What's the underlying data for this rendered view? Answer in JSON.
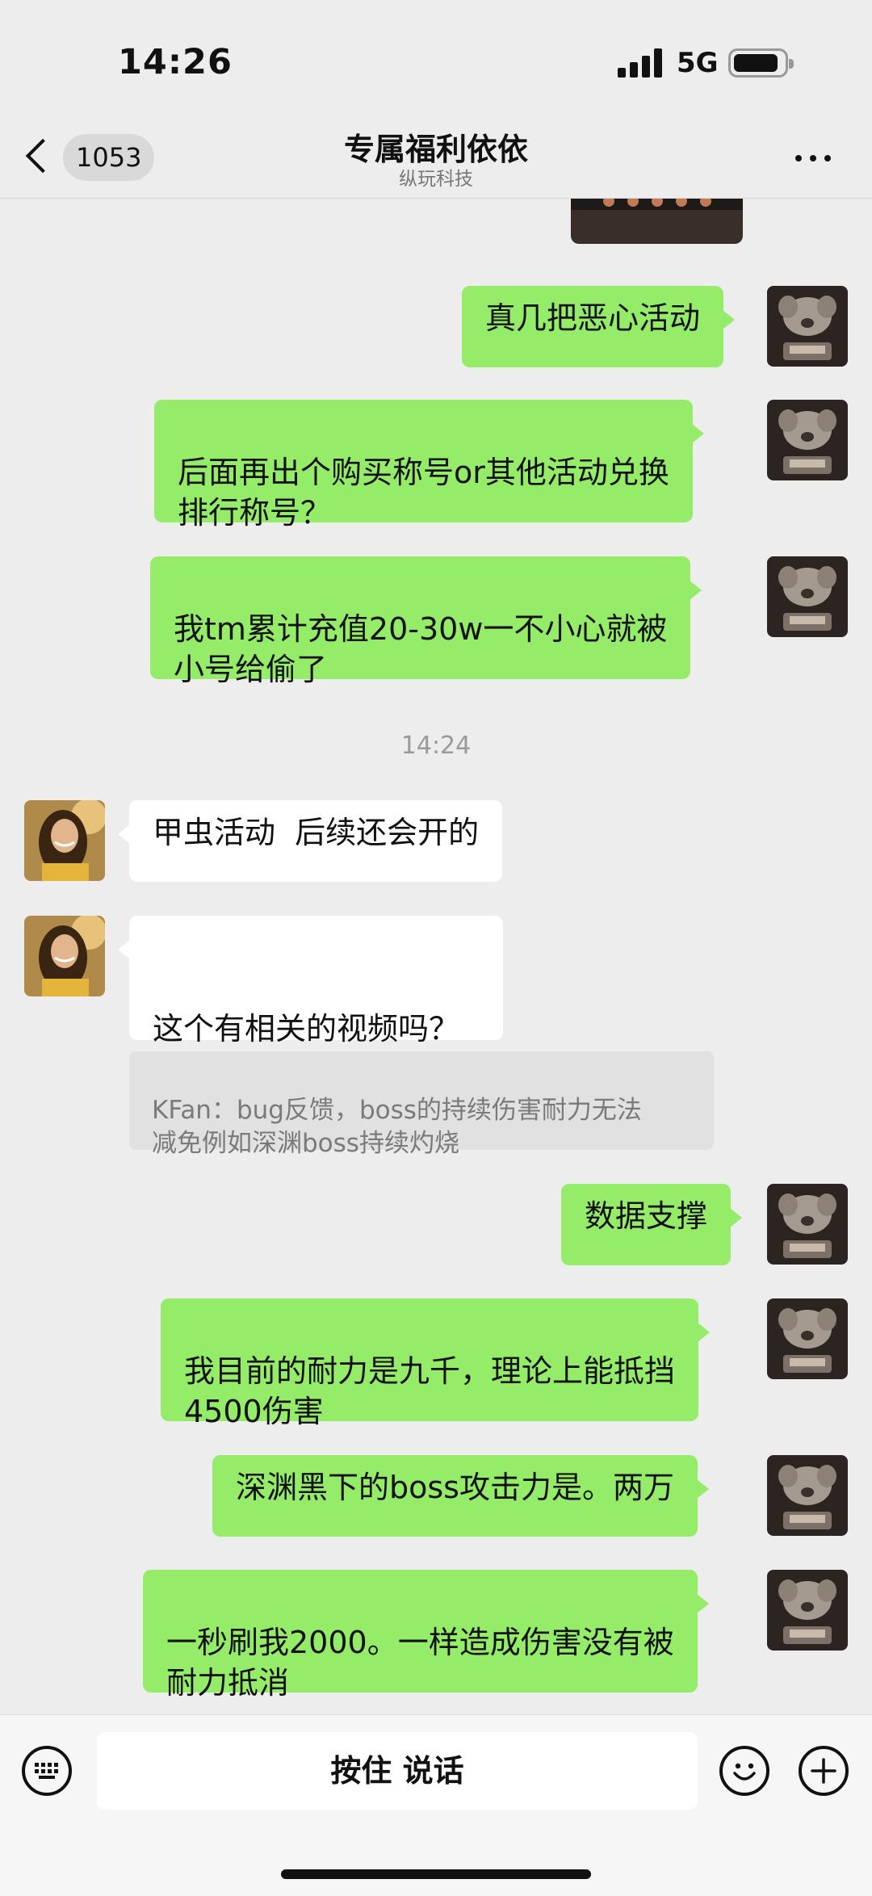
{
  "status_bar": {
    "time": "14:26",
    "network": "5G",
    "signal_icon": "signal-bars-icon",
    "battery_icon": "battery-icon"
  },
  "nav": {
    "back_icon": "chevron-left-icon",
    "unread_count": "1053",
    "title": "专属福利依依",
    "subtitle": "纵玩科技",
    "more_icon": "more-horizontal-icon"
  },
  "messages": [
    {
      "side": "out",
      "text": "真几把恶心活动"
    },
    {
      "side": "out",
      "text": "后面再出个购买称号or其他活动兑换\n排行称号？"
    },
    {
      "side": "out",
      "text": "我tm累计充值20-30w一不小心就被\n小号给偷了"
    },
    {
      "side": "in",
      "text": "甲虫活动  后续还会开的"
    },
    {
      "side": "in",
      "text": "\n这个有相关的视频吗？"
    },
    {
      "side": "out",
      "text": "数据支撑"
    },
    {
      "side": "out",
      "text": "我目前的耐力是九千，理论上能抵挡\n4500伤害"
    },
    {
      "side": "out",
      "text": "深渊黑下的boss攻击力是。两万"
    },
    {
      "side": "out",
      "text": "一秒刷我2000。一样造成伤害没有被\n耐力抵消"
    }
  ],
  "timestamp": "14:24",
  "quote": {
    "text": "KFan：bug反馈，boss的持续伤害耐力无法\n减免例如深渊boss持续灼烧"
  },
  "input_bar": {
    "voice_label": "按住 说话",
    "keyboard_icon": "keyboard-icon",
    "emoji_icon": "emoji-smile-icon",
    "plus_icon": "plus-circle-icon"
  },
  "colors": {
    "outgoing_bubble": "#95ec69",
    "incoming_bubble": "#ffffff",
    "background": "#ededed"
  }
}
